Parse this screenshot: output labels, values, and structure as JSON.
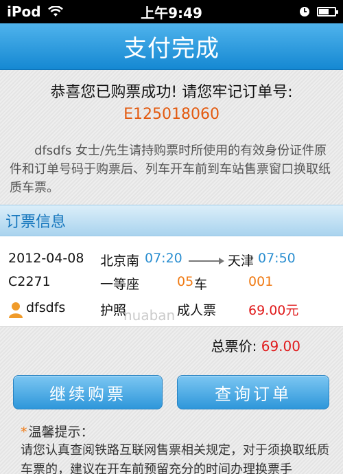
{
  "status_bar": {
    "device": "iPod",
    "time": "上午9:49"
  },
  "header": {
    "title": "支付完成"
  },
  "success": {
    "message": "恭喜您已购票成功! 请您牢记订单号:",
    "order_number": "E125018060",
    "notice": "dfsdfs 女士/先生请持购票时所使用的有效身份证件原件和订单号码于购票后、列车开车前到车站售票窗口换取纸质车票。"
  },
  "ticket_section": {
    "title": "订票信息",
    "date": "2012-04-08",
    "from_station": "北京南",
    "depart_time": "07:20",
    "to_station": "天津",
    "arrive_time": "07:50",
    "train_no": "C2271",
    "seat_class": "一等座",
    "car_no": "05",
    "car_unit": "车",
    "seat_no": "001",
    "passenger": "dfsdfs",
    "id_type": "护照",
    "ticket_type": "成人票",
    "price": "69.00元"
  },
  "total": {
    "label": "总票价:",
    "amount": "69.00"
  },
  "buttons": {
    "continue": "继续购票",
    "query": "查询订单"
  },
  "tips": {
    "title": "温馨提示：",
    "body": "请您认真查阅铁路互联网售票相关规定，对于须换取纸质车票的，建议在开车前预留充分的时间办理换票手"
  },
  "watermark": "huaban",
  "colors": {
    "header_blue": "#1588d2",
    "order_orange": "#e35a0f",
    "time_blue": "#2a8ed0",
    "price_red": "#e0191a"
  }
}
